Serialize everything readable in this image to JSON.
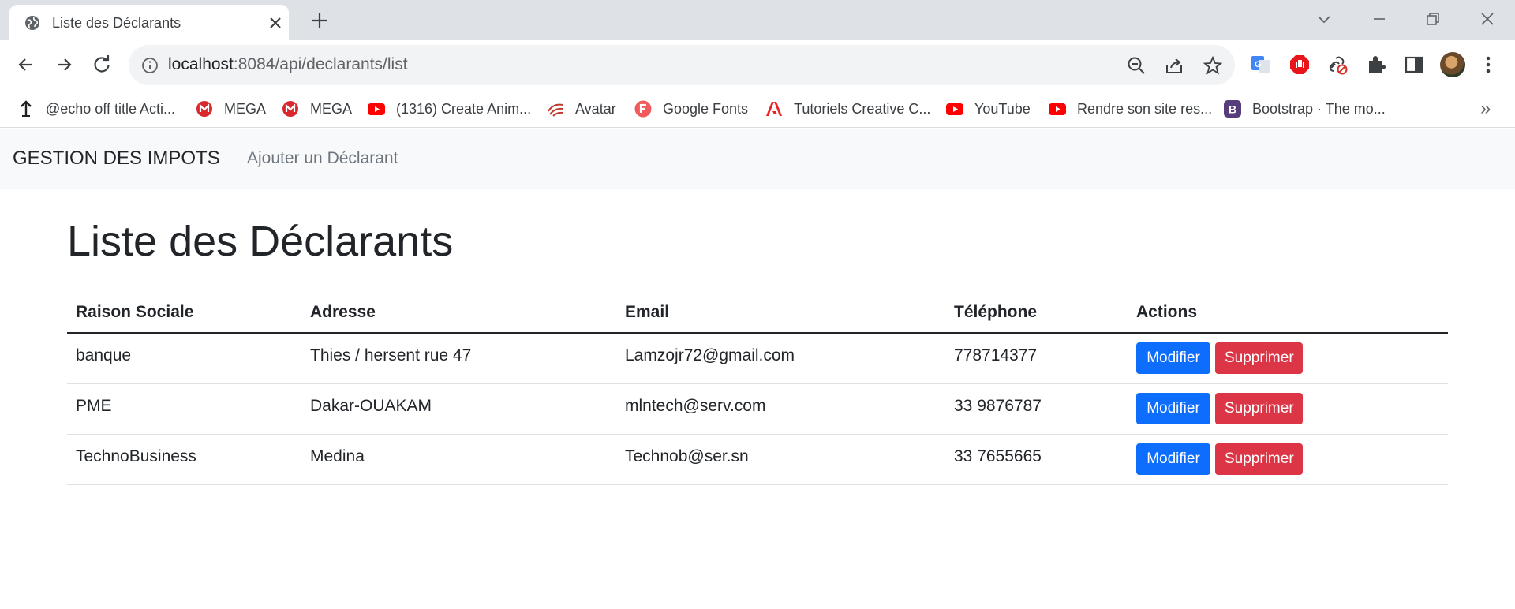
{
  "browser": {
    "tab_title": "Liste des Déclarants",
    "url_host": "localhost",
    "url_path": ":8084/api/declarants/list",
    "bookmarks": [
      {
        "label": "@echo off title Acti...",
        "icon": "pin-icon"
      },
      {
        "label": "MEGA",
        "icon": "mega-icon",
        "color": "#d9272e"
      },
      {
        "label": "MEGA",
        "icon": "mega-icon",
        "color": "#d9272e"
      },
      {
        "label": "(1316) Create Anim...",
        "icon": "youtube-icon",
        "color": "#ff0000"
      },
      {
        "label": "Avatar",
        "icon": "avatar-swirl-icon",
        "color": "#c0392b"
      },
      {
        "label": "Google Fonts",
        "icon": "google-fonts-icon",
        "color": "#f15a5a"
      },
      {
        "label": "Tutoriels Creative C...",
        "icon": "adobe-icon",
        "color": "#ed2224"
      },
      {
        "label": "YouTube",
        "icon": "youtube-icon",
        "color": "#ff0000"
      },
      {
        "label": "Rendre son site res...",
        "icon": "youtube-icon",
        "color": "#ff0000"
      },
      {
        "label": "Bootstrap · The mo...",
        "icon": "bootstrap-icon",
        "color": "#563d7c"
      }
    ],
    "more_bookmarks": "»"
  },
  "navbar": {
    "brand": "GESTION DES IMPOTS",
    "link": "Ajouter un Déclarant"
  },
  "page": {
    "title": "Liste des Déclarants"
  },
  "table": {
    "headers": [
      "Raison Sociale",
      "Adresse",
      "Email",
      "Téléphone",
      "Actions"
    ],
    "rows": [
      {
        "raison": "banque",
        "adresse": "Thies / hersent rue 47",
        "email": "Lamzojr72@gmail.com",
        "telephone": "778714377"
      },
      {
        "raison": "PME",
        "adresse": "Dakar-OUAKAM",
        "email": "mlntech@serv.com",
        "telephone": "33 9876787"
      },
      {
        "raison": "TechnoBusiness",
        "adresse": "Medina",
        "email": "Technob@ser.sn",
        "telephone": "33 7655665"
      }
    ],
    "edit_label": "Modifier",
    "delete_label": "Supprimer"
  },
  "colors": {
    "primary": "#0d6efd",
    "danger": "#dc3545",
    "navbar_bg": "#f8f9fa"
  }
}
